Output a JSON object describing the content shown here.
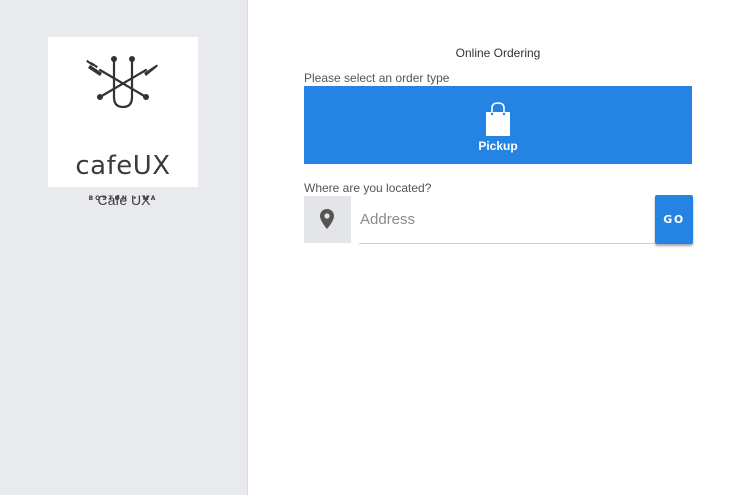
{
  "sidebar": {
    "logo": {
      "wordmark": "cafeUX",
      "subtitle": "BOSTON • MA",
      "icon": "fork-knife-u-logo"
    },
    "cafe_name": "Cafe UX"
  },
  "main": {
    "title": "Online Ordering",
    "order_type_label": "Please select an order type",
    "order_types": [
      {
        "label": "Pickup",
        "icon": "shopping-bag-icon"
      }
    ],
    "location_label": "Where are you located?",
    "address": {
      "placeholder": "Address",
      "value": "",
      "icon": "map-pin-icon"
    },
    "go_label": "GO"
  },
  "colors": {
    "accent": "#2583e3",
    "sidebar_bg": "#e9eaee",
    "pin_box_bg": "#e4e5e9"
  }
}
